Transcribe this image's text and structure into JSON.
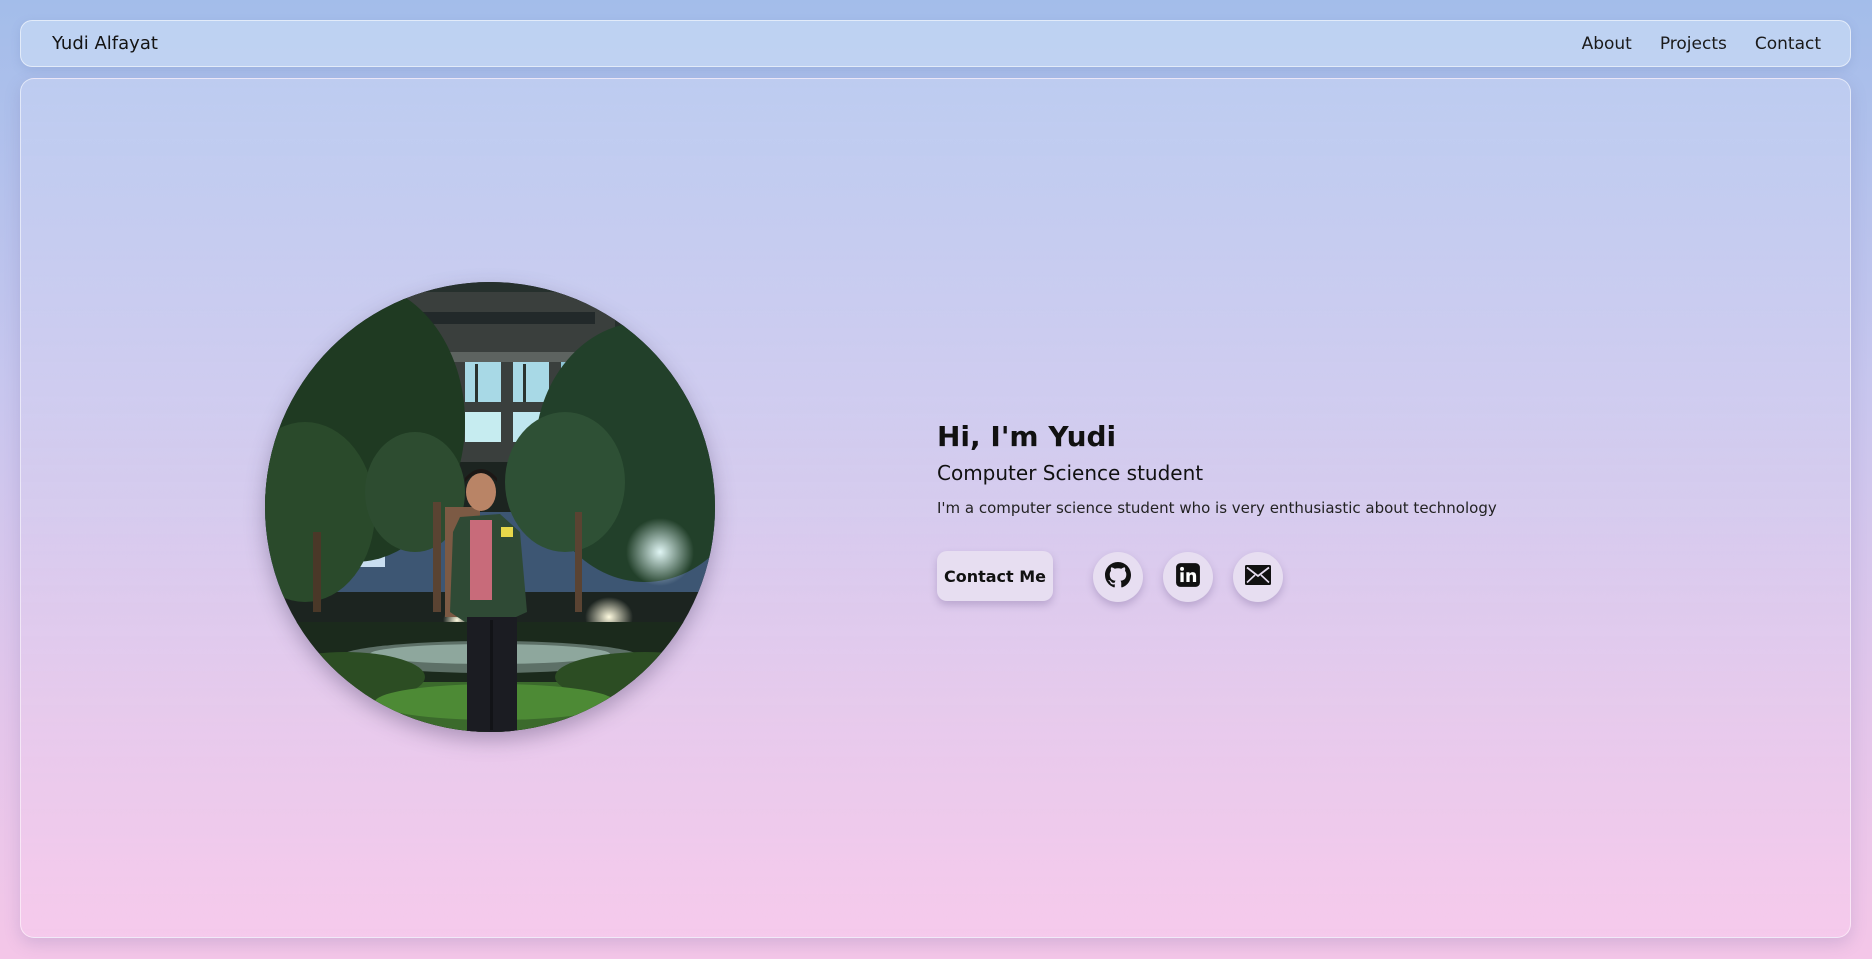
{
  "navbar": {
    "brand": "Yudi Alfayat",
    "links": [
      {
        "label": "About"
      },
      {
        "label": "Projects"
      },
      {
        "label": "Contact"
      }
    ]
  },
  "hero": {
    "greeting": "Hi, I'm Yudi",
    "role": "Computer Science student",
    "bio": "I'm a computer science student who is very enthusiastic about technology",
    "contact_button": "Contact Me",
    "social_links": [
      {
        "icon": "github-icon"
      },
      {
        "icon": "linkedin-icon"
      },
      {
        "icon": "email-icon"
      }
    ],
    "photo": {
      "alt": "profile photo"
    }
  },
  "colors": {
    "button_bg": "#e7def1",
    "text": "#111111"
  }
}
